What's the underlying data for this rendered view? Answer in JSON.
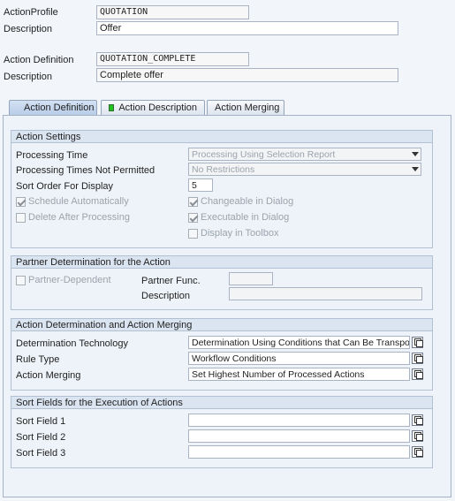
{
  "header": {
    "action_profile_label": "ActionProfile",
    "action_profile_value": "QUOTATION",
    "description1_label": "Description",
    "description1_value": "Offer",
    "action_definition_label": "Action Definition",
    "action_definition_value": "QUOTATION_COMPLETE",
    "description2_label": "Description",
    "description2_value": "Complete offer"
  },
  "tabs": [
    {
      "label": "Action Definition"
    },
    {
      "label": "Action Description"
    },
    {
      "label": "Action Merging"
    }
  ],
  "action_settings": {
    "title": "Action Settings",
    "processing_time_label": "Processing Time",
    "processing_time_value": "Processing Using Selection Report",
    "not_permitted_label": "Processing Times Not Permitted",
    "not_permitted_value": "No Restrictions",
    "sort_order_label": "Sort Order For Display",
    "sort_order_value": "5",
    "schedule_auto": "Schedule Automatically",
    "delete_after": "Delete After Processing",
    "changeable": "Changeable in Dialog",
    "executable": "Executable in Dialog",
    "display_toolbox": "Display in Toolbox"
  },
  "partner": {
    "title": "Partner Determination for the Action",
    "partner_dependent": "Partner-Dependent",
    "partner_func_label": "Partner Func.",
    "partner_func_value": "",
    "description_label": "Description",
    "description_value": ""
  },
  "determination": {
    "title": "Action Determination and Action Merging",
    "technology_label": "Determination Technology",
    "technology_value": "Determination Using Conditions that Can Be Transport...",
    "rule_type_label": "Rule Type",
    "rule_type_value": "Workflow Conditions",
    "merging_label": "Action Merging",
    "merging_value": "Set Highest Number of Processed Actions"
  },
  "sort_fields": {
    "title": "Sort Fields for the Execution of Actions",
    "field1_label": "Sort Field 1",
    "field2_label": "Sort Field 2",
    "field3_label": "Sort Field 3",
    "field1_value": "",
    "field2_value": "",
    "field3_value": ""
  }
}
